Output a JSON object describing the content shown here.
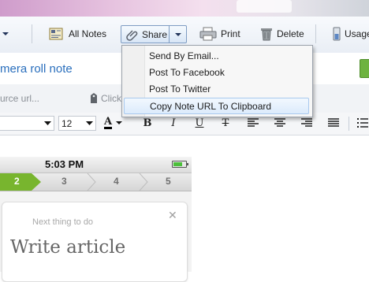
{
  "toolbar": {
    "all_notes": "All Notes",
    "share": "Share",
    "print": "Print",
    "delete": "Delete",
    "usage": "Usage"
  },
  "share_menu": {
    "items": [
      {
        "label": "Send By Email..."
      },
      {
        "label": "Post To Facebook"
      },
      {
        "label": "Post To Twitter"
      },
      {
        "label": "Copy Note URL To Clipboard"
      }
    ]
  },
  "note": {
    "title": "mera roll note",
    "source_url_placeholder": "urce url...",
    "click_text": "Click"
  },
  "format": {
    "font_size": "12",
    "bold": "B",
    "italic": "I",
    "underline": "U",
    "strike": "T",
    "text_color_label": "A"
  },
  "phone": {
    "time": "5:03 PM",
    "steps": [
      "2",
      "3",
      "4",
      "5"
    ],
    "active_step": "2",
    "card_subtitle": "Next thing to do",
    "card_title": "Write article",
    "close_glyph": "✕"
  },
  "colors": {
    "accent_link": "#2a6fbd",
    "step_active": "#78b52e",
    "evernote_green": "#6db33f"
  }
}
